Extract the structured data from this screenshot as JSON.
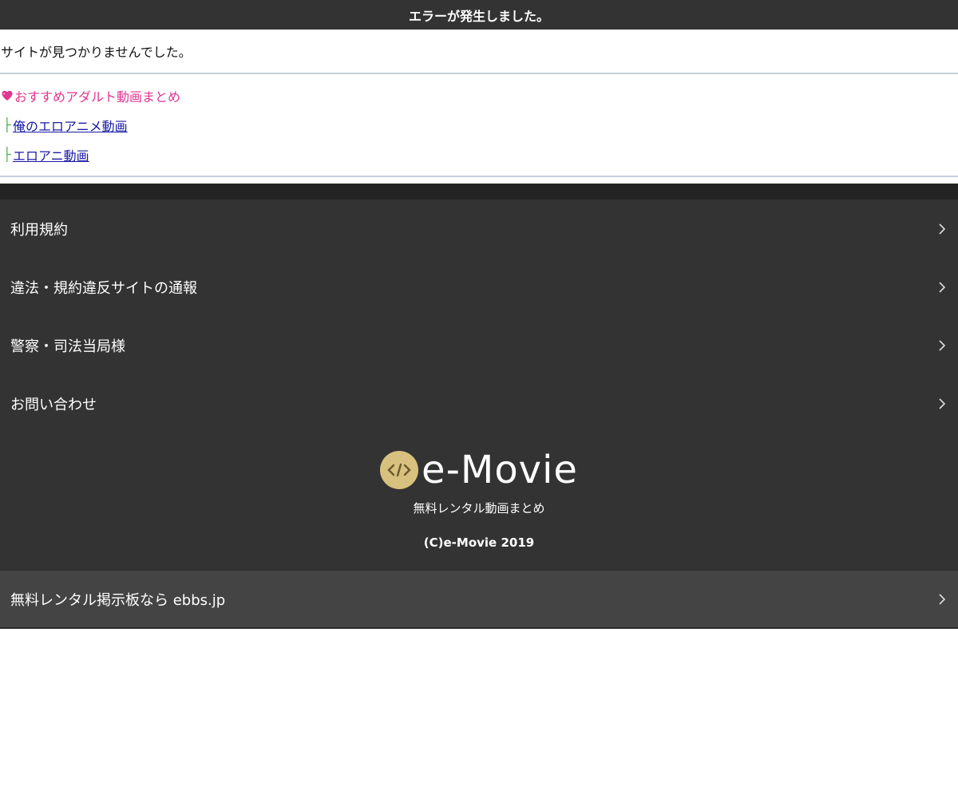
{
  "header": {
    "title": "エラーが発生しました。"
  },
  "error": {
    "message": "サイトが見つかりませんでした。"
  },
  "recommendations": {
    "title": "おすすめアダルト動画まとめ",
    "links": [
      {
        "label": "俺のエロアニメ動画"
      },
      {
        "label": "エロアニ動画"
      }
    ]
  },
  "footer_menu": {
    "items": [
      {
        "label": "利用規約"
      },
      {
        "label": "違法・規約違反サイトの通報"
      },
      {
        "label": "警察・司法当局様"
      },
      {
        "label": "お問い合わせ"
      }
    ]
  },
  "brand": {
    "logo_text": "e-Movie",
    "tagline": "無料レンタル動画まとめ",
    "copyright": "(C)e-Movie 2019"
  },
  "promo": {
    "label": "無料レンタル掲示板なら ebbs.jp"
  },
  "colors": {
    "dark_bg": "#333333",
    "promo_bg": "#444444",
    "accent_pink": "#e1358f",
    "link_blue": "#1a1aa6",
    "logo_gold": "#d8c07e",
    "play_red": "#d0312d"
  }
}
